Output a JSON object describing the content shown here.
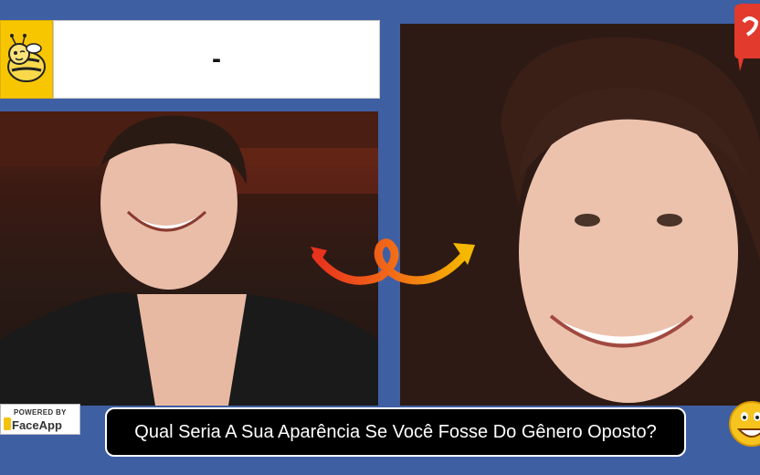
{
  "header": {
    "name_text": "-"
  },
  "badge": {
    "powered_by": "POWERED BY",
    "app_name": "FaceApp"
  },
  "caption": {
    "text": "Qual Seria A Sua Aparência Se Você Fosse Do Gênero Oposto?"
  },
  "icons": {
    "logo": "bee-mascot-icon",
    "arrow": "curly-arrow-icon",
    "bubble": "speech-bubble-icon",
    "emoji": "grinning-emoji-icon"
  },
  "colors": {
    "background": "#3f5fa3",
    "logo_yellow": "#f7c600",
    "arrow_red": "#e8331e",
    "arrow_yellow": "#f5b800",
    "caption_bg": "#000000"
  }
}
